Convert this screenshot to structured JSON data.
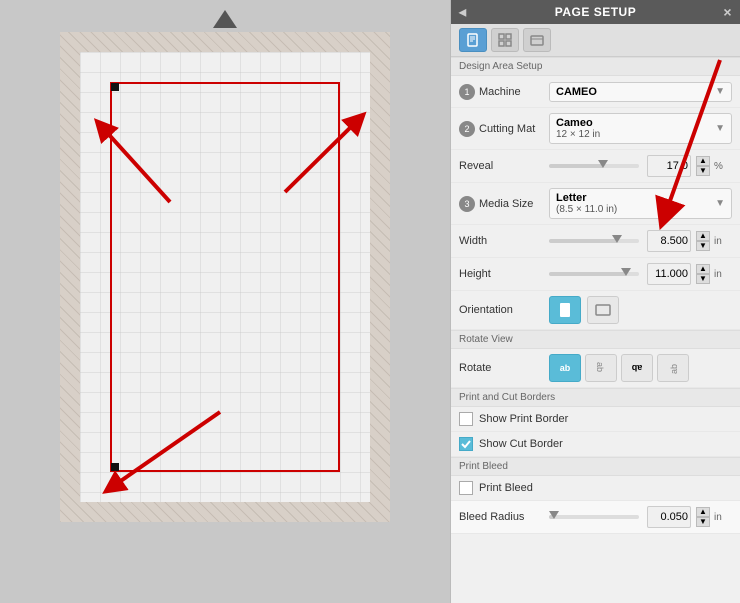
{
  "panel": {
    "title": "PAGE SETUP",
    "close_icon": "×",
    "collapse_icon": "◂"
  },
  "tabs": [
    {
      "id": "page",
      "label": "☐",
      "active": true,
      "icon": "page-icon"
    },
    {
      "id": "grid",
      "label": "⊞",
      "active": false,
      "icon": "grid-icon"
    },
    {
      "id": "media",
      "label": "▪",
      "active": false,
      "icon": "media-icon"
    }
  ],
  "section_label": "Design Area Setup",
  "fields": {
    "machine_label": "Machine",
    "machine_value": "CAMEO",
    "cutting_mat_label": "Cutting Mat",
    "cutting_mat_line1": "Cameo",
    "cutting_mat_line2": "12 × 12 in",
    "reveal_label": "Reveal",
    "reveal_value": "17.0",
    "reveal_unit": "%",
    "media_size_label": "Media Size",
    "media_size_line1": "Letter",
    "media_size_line2": "(8.5 × 11.0 in)",
    "width_label": "Width",
    "width_value": "8.500",
    "width_unit": "in",
    "height_label": "Height",
    "height_value": "11.000",
    "height_unit": "in",
    "orientation_label": "Orientation",
    "rotate_view_label": "Rotate View",
    "rotate_label": "Rotate",
    "print_cut_label": "Print and Cut Borders",
    "show_print_border_label": "Show Print Border",
    "show_cut_border_label": "Show Cut Border",
    "print_bleed_section": "Print Bleed",
    "print_bleed_label": "Print Bleed",
    "bleed_radius_label": "Bleed Radius",
    "bleed_radius_value": "0.050",
    "bleed_radius_unit": "in"
  },
  "rotate_options": [
    "ab",
    "🔁",
    "qb",
    "bq"
  ],
  "show_cut_border_checked": true,
  "show_print_border_checked": false,
  "print_bleed_checked": false
}
